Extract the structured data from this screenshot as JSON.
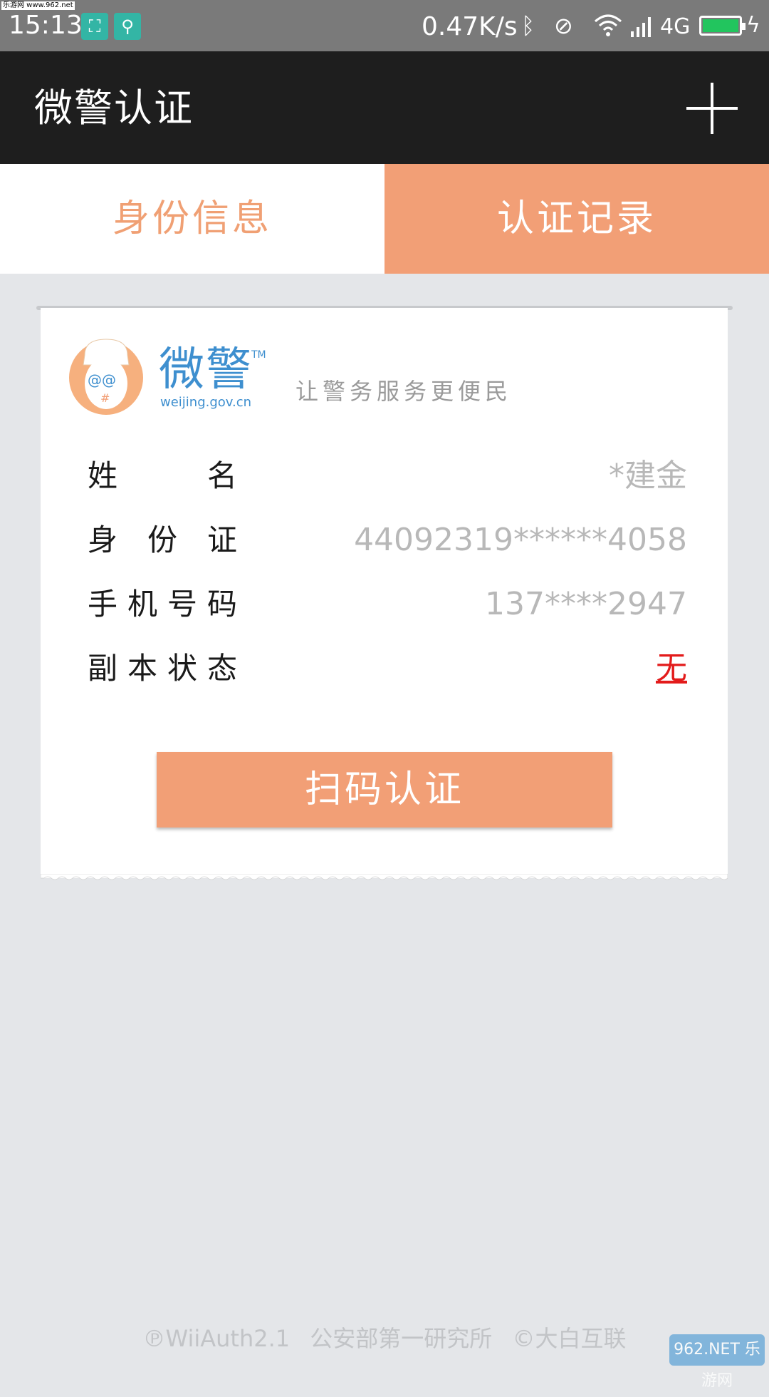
{
  "status_bar": {
    "watermark": "乐游网 www.962.net",
    "time": "15:13",
    "net_speed": "0.47K/s",
    "network": "4G",
    "battery_color": "#22c55e",
    "icons": [
      "screenshot-icon",
      "usb-icon",
      "bluetooth-icon",
      "mute-vibrate-icon",
      "wifi-icon",
      "signal-icon",
      "battery-icon",
      "charging-icon"
    ]
  },
  "appbar": {
    "title": "微警认证",
    "add_icon": "plus-icon"
  },
  "tabs": [
    {
      "label": "身份信息",
      "active": false
    },
    {
      "label": "认证记录",
      "active": true
    }
  ],
  "card": {
    "logo": {
      "word": "微警",
      "tm": "TM",
      "url": "weijing.gov.cn"
    },
    "slogan": "让警务服务更便民",
    "rows": [
      {
        "label": "姓名",
        "value": "*建金"
      },
      {
        "label": "身份证",
        "value": "44092319******4058"
      },
      {
        "label": "手机号码",
        "value": "137****2947"
      },
      {
        "label": "副本状态",
        "value": "无"
      }
    ],
    "scan_button": "扫码认证"
  },
  "footer": {
    "left": "℗WiiAuth2.1",
    "middle": "公安部第一研究所",
    "right": "©大白互联"
  },
  "watermark_badge": "962.NET 乐游网",
  "colors": {
    "accent": "#f29f76",
    "appbar": "#1e1e1e",
    "background": "#e4e6e9",
    "status_red": "#e31b1b"
  }
}
